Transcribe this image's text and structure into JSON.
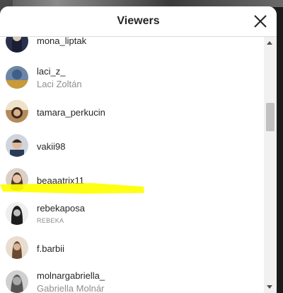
{
  "header": {
    "title": "Viewers"
  },
  "icons": {
    "close": "close-icon",
    "scroll_up": "chevron-up-icon",
    "scroll_down": "chevron-down-icon"
  },
  "colors": {
    "highlight": "#ffff00",
    "username": "#262626",
    "fullname": "#8e8e8e",
    "divider": "#dbdbdb"
  },
  "viewers": [
    {
      "username": "mona_liptak",
      "fullname": ""
    },
    {
      "username": "laci_z_",
      "fullname": "Laci Zoltán"
    },
    {
      "username": "tamara_perkucin",
      "fullname": ""
    },
    {
      "username": "vakii98",
      "fullname": ""
    },
    {
      "username": "beaaatrix11",
      "fullname": ""
    },
    {
      "username": "rebekaposa",
      "fullname": "REBEKA"
    },
    {
      "username": "f.barbii",
      "fullname": ""
    },
    {
      "username": "molnargabriella_",
      "fullname": "Gabriella Molnár"
    }
  ]
}
